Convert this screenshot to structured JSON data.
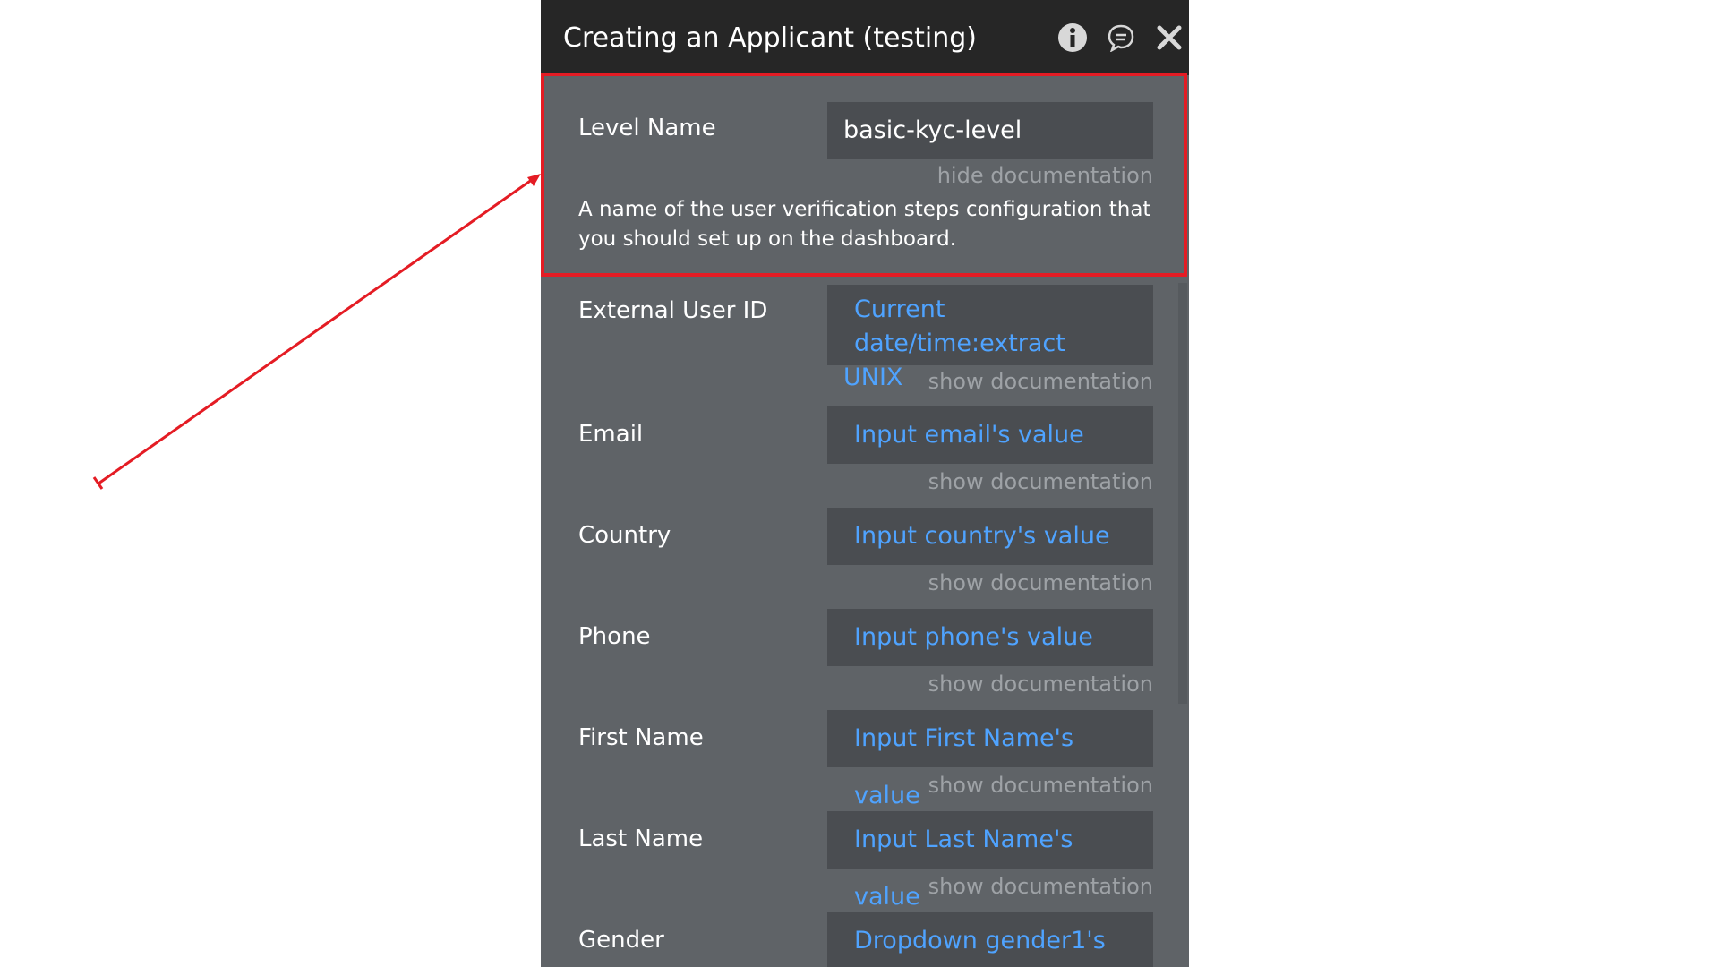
{
  "panel": {
    "title": "Creating an Applicant (testing)",
    "icons": {
      "info": "info-icon",
      "comment": "comment-icon",
      "close": "close-icon"
    }
  },
  "fields": [
    {
      "label": "Level Name",
      "value": "basic-kyc-level",
      "value_type": "static",
      "doc_link": "hide documentation",
      "doc_text": "A name of the user verification steps configuration that you should set up on the dashboard."
    },
    {
      "label": "External User ID",
      "value_line1": "Current date/time:extract",
      "value_line2": "UNIX",
      "value_type": "dynamic",
      "doc_link": "show documentation"
    },
    {
      "label": "Email",
      "value": "Input email's value",
      "value_type": "dynamic",
      "doc_link": "show documentation"
    },
    {
      "label": "Country",
      "value": "Input country's value",
      "value_type": "dynamic",
      "doc_link": "show documentation"
    },
    {
      "label": "Phone",
      "value": "Input phone's value",
      "value_type": "dynamic",
      "doc_link": "show documentation"
    },
    {
      "label": "First Name",
      "value": "Input First Name's value",
      "value_type": "dynamic",
      "doc_link": "show documentation"
    },
    {
      "label": "Last Name",
      "value": "Input Last Name's value",
      "value_type": "dynamic",
      "doc_link": "show documentation"
    },
    {
      "label": "Gender",
      "value": "Dropdown gender1's",
      "value_type": "dynamic"
    }
  ],
  "colors": {
    "panel_bg": "#5f6367",
    "titlebar_bg": "#262626",
    "field_bg": "#4a4d51",
    "dynamic_text": "#4fa3ff",
    "doc_link": "#9ea2a6",
    "highlight": "#e41c24"
  }
}
